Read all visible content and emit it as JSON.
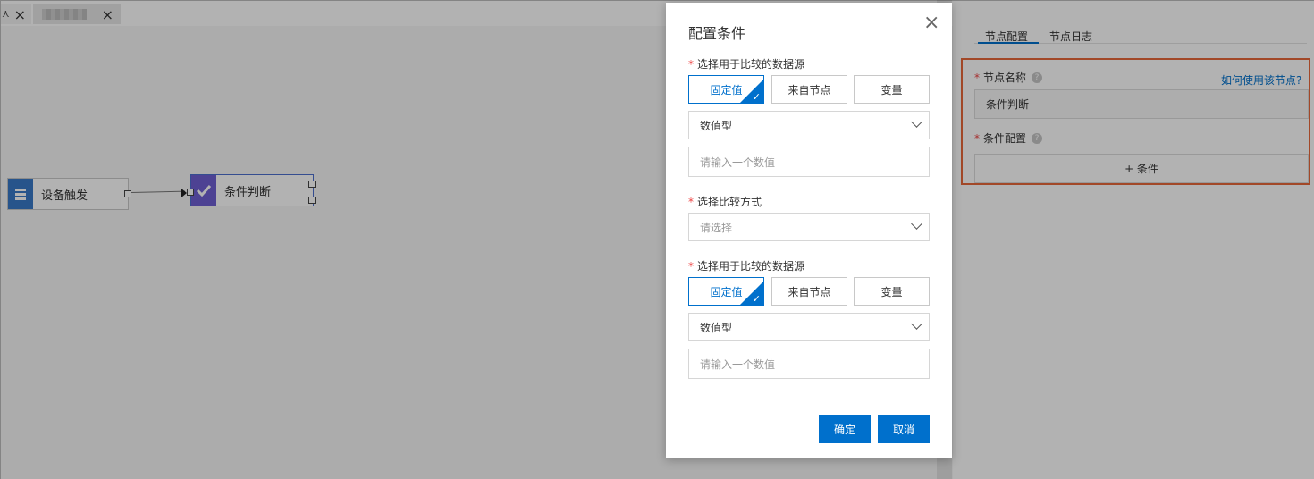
{
  "tabs": [
    {
      "label": ""
    },
    {
      "label": ""
    }
  ],
  "canvas": {
    "nodes": [
      {
        "label": "设备触发"
      },
      {
        "label": "条件判断"
      }
    ]
  },
  "right_panel": {
    "tabs": [
      {
        "label": "节点配置",
        "active": true
      },
      {
        "label": "节点日志",
        "active": false
      }
    ],
    "node_name_label": "节点名称",
    "help_link": "如何使用该节点?",
    "node_name_value": "条件判断",
    "condition_config_label": "条件配置",
    "add_condition_label": "+ 条件"
  },
  "dialog": {
    "title": "配置条件",
    "source1": {
      "label": "选择用于比较的数据源",
      "options": [
        "固定值",
        "来自节点",
        "变量"
      ],
      "selected": "固定值",
      "type_value": "数值型",
      "input_placeholder": "请输入一个数值"
    },
    "compare": {
      "label": "选择比较方式",
      "placeholder": "请选择"
    },
    "source2": {
      "label": "选择用于比较的数据源",
      "options": [
        "固定值",
        "来自节点",
        "变量"
      ],
      "selected": "固定值",
      "type_value": "数值型",
      "input_placeholder": "请输入一个数值"
    },
    "ok_label": "确定",
    "cancel_label": "取消"
  },
  "colors": {
    "primary": "#0070cc",
    "highlight": "#e9683a",
    "required": "#e44444"
  }
}
